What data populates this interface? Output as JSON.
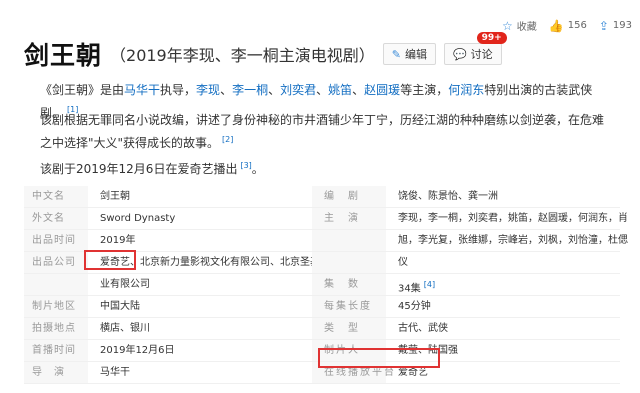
{
  "topbar": {
    "collect_label": "收藏",
    "like_count": "156",
    "share_count": "193"
  },
  "header": {
    "title": "剑王朝",
    "subtitle": "（2019年李现、李一桐主演电视剧）",
    "edit_label": "编辑",
    "discuss_label": "讨论",
    "discuss_badge": "99+"
  },
  "summary": {
    "p1_a": "《剑王朝》是由",
    "p1_director": "马华干",
    "p1_b": "执导，",
    "p1_actor1": "李现",
    "p1_sep1": "、",
    "p1_actor2": "李一桐",
    "p1_sep2": "、",
    "p1_actor3": "刘奕君",
    "p1_sep3": "、",
    "p1_actor4": "姚笛",
    "p1_sep4": "、",
    "p1_actor5": "赵圆瑗",
    "p1_c": "等主演，",
    "p1_guest": "何润东",
    "p1_d": "特别出演的古装武侠剧。",
    "p1_ref": "[1]",
    "p2": "该剧根据无罪同名小说改编，讲述了身份神秘的市井酒铺少年丁宁，历经江湖的种种磨练以剑逆袭，在危难之中选择\"大义\"获得成长的故事。",
    "p2_ref": "[2]",
    "p3": "该剧于2019年12月6日在爱奇艺播出",
    "p3_ref": "[3]",
    "p3_end": "。"
  },
  "info": {
    "rows": [
      {
        "k": "中文名",
        "v": "剑王朝",
        "k2": "编　剧",
        "v2": "饶俊、陈景怡、龚一洲"
      },
      {
        "k": "外文名",
        "v": "Sword Dynasty",
        "k2": "主　演",
        "v2": "李现，李一桐，刘奕君，姚笛，赵圆瑗，何润东，肖"
      },
      {
        "k": "出品时间",
        "v": "2019年",
        "k2": "",
        "v2": "旭，李光复，张维娜，宗峰岩，刘枫，刘怡潼，杜偲"
      },
      {
        "k": "出品公司",
        "v": "爱奇艺、北京新力量影视文化有限公司、北京圣基影",
        "k2": "",
        "v2": "仪"
      },
      {
        "k": "",
        "v": "业有限公司",
        "k2": "集　数",
        "v2": "34集",
        "v2_ref": "[4]"
      },
      {
        "k": "制片地区",
        "v": "中国大陆",
        "k2": "每集长度",
        "v2": "45分钟"
      },
      {
        "k": "拍摄地点",
        "v": "横店、银川",
        "k2": "类　型",
        "v2": "古代、武侠"
      },
      {
        "k": "首播时间",
        "v": "2019年12月6日",
        "k2": "制片人",
        "v2": "戴莹、陆国强"
      },
      {
        "k": "导　演",
        "v": "马华干",
        "k2": "在线播放平台",
        "v2": "爱奇艺"
      }
    ]
  },
  "colors": {
    "link": "#136ec2",
    "highlight_box": "#e03333",
    "badge": "#e1251b"
  }
}
